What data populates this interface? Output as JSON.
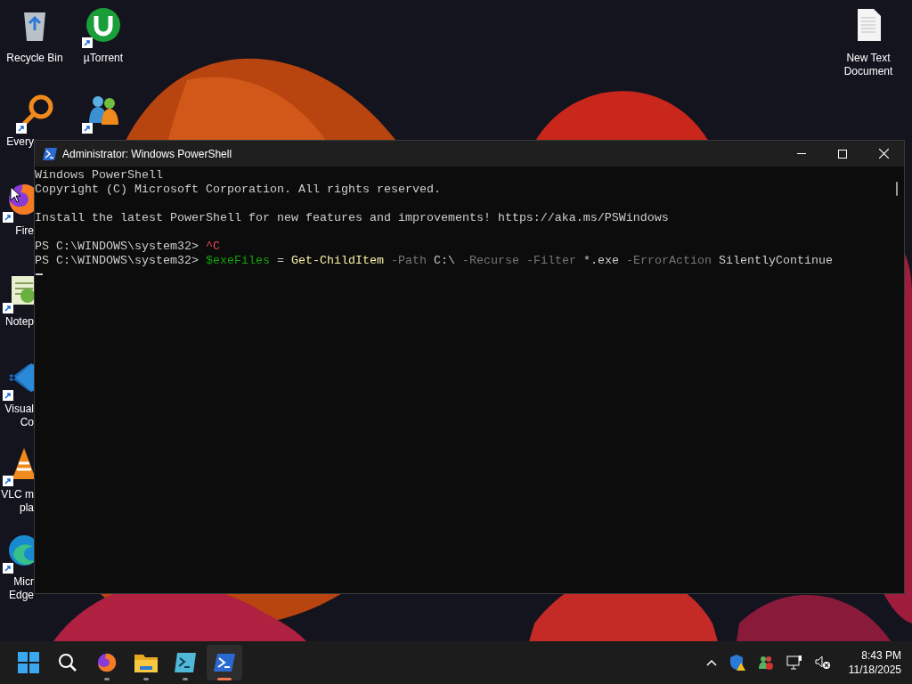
{
  "desktop": {
    "icons": [
      {
        "kind": "recycle-bin",
        "shortcut": false,
        "label": [
          "Recycle Bin"
        ]
      },
      {
        "kind": "torrent",
        "shortcut": true,
        "label": [
          "µTorrent"
        ]
      },
      {
        "kind": "file-search",
        "shortcut": true,
        "label": [
          "Every"
        ]
      },
      {
        "kind": "messenger",
        "shortcut": true
      },
      {
        "kind": "browser",
        "shortcut": true,
        "label": [
          "Fire"
        ]
      },
      {
        "kind": "notepad",
        "shortcut": true,
        "label": [
          "Notep"
        ]
      },
      {
        "kind": "code-editor",
        "shortcut": true,
        "label": [
          "Visual",
          "Co"
        ]
      },
      {
        "kind": "media-player",
        "shortcut": true,
        "label": [
          "VLC m",
          "pla"
        ]
      },
      {
        "kind": "edge",
        "shortcut": true,
        "label": [
          "Micr",
          "Edge"
        ]
      },
      {
        "kind": "text-file",
        "shortcut": false,
        "label": [
          "New Text",
          "Document"
        ]
      }
    ]
  },
  "window": {
    "title": "Administrator: Windows PowerShell",
    "paragraphs": [
      [
        [
          {
            "kind": "plain",
            "text": "Windows PowerShell"
          }
        ],
        [
          {
            "kind": "plain",
            "text": "Copyright (C) Microsoft Corporation. All rights reserved."
          }
        ]
      ],
      [
        [
          {
            "kind": "plain",
            "text": "Install the latest PowerShell for new features and improvements! https://aka.ms/PSWindows"
          }
        ]
      ],
      [
        [
          {
            "kind": "plain",
            "text": "PS C:\\WINDOWS\\system32> "
          },
          {
            "kind": "error",
            "text": "^C"
          }
        ],
        [
          {
            "kind": "plain",
            "text": "PS C:\\WINDOWS\\system32> "
          },
          {
            "kind": "variable",
            "text": "$exeFiles"
          },
          {
            "kind": "plain",
            "text": " = "
          },
          {
            "kind": "command",
            "text": "Get-ChildItem"
          },
          {
            "kind": "parameter",
            "text": " -Path"
          },
          {
            "kind": "plain",
            "text": " C:\\"
          },
          {
            "kind": "parameter",
            "text": " -Recurse -Filter"
          },
          {
            "kind": "plain",
            "text": " *.exe"
          },
          {
            "kind": "parameter",
            "text": " -ErrorAction"
          },
          {
            "kind": "plain",
            "text": " SilentlyContinue"
          }
        ]
      ]
    ]
  },
  "taskbar": {
    "apps": [
      {
        "kind": "start",
        "running": false,
        "selected": false
      },
      {
        "kind": "search",
        "running": false,
        "selected": false
      },
      {
        "kind": "browser",
        "running": true,
        "selected": false
      },
      {
        "kind": "folder",
        "running": true,
        "selected": false
      },
      {
        "kind": "terminal",
        "running": true,
        "selected": false
      },
      {
        "kind": "powershell",
        "running": true,
        "selected": true
      }
    ],
    "tray": [
      {
        "kind": "chevron"
      },
      {
        "kind": "shield-warning"
      },
      {
        "kind": "people"
      },
      {
        "kind": "network"
      },
      {
        "kind": "volume-muted"
      }
    ],
    "time": "8:43 PM",
    "date": "11/18/2025"
  }
}
